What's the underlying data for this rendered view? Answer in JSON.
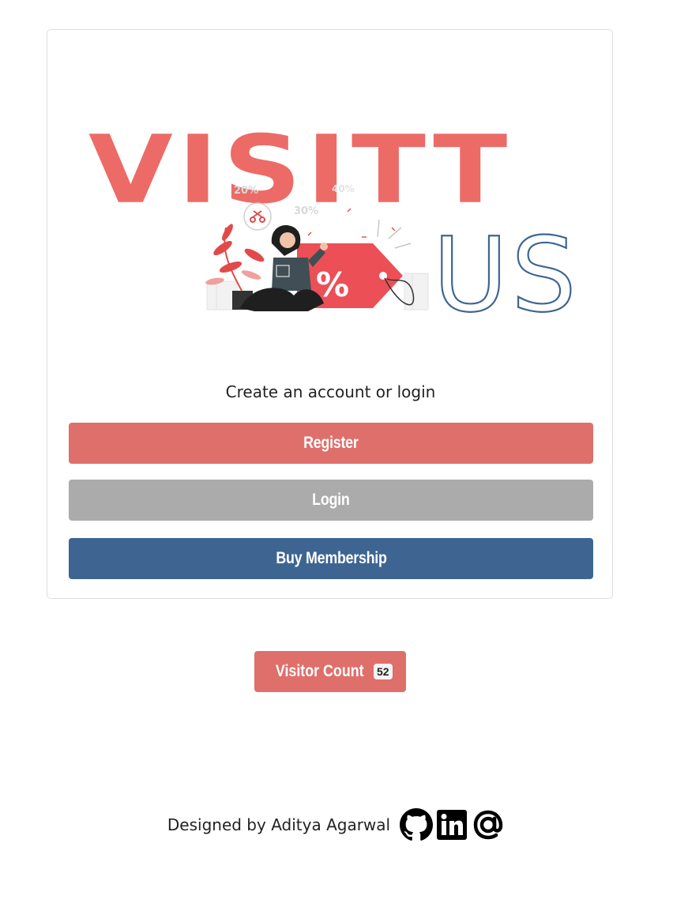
{
  "logo": {
    "wordmark_top": "VISITT",
    "wordmark_bottom": "US",
    "tag_text": "%",
    "percent_labels": [
      "20%",
      "30%",
      "40%"
    ],
    "wordmark_color": "#ec6b67",
    "us_color": "#3e6592"
  },
  "card": {
    "tagline": "Create an account or login",
    "register_label": "Register",
    "login_label": "Login",
    "membership_label": "Buy Membership"
  },
  "visitor": {
    "label": "Visitor Count",
    "count": "52"
  },
  "footer": {
    "credit": "Designed by Aditya Agarwal",
    "icons": [
      "github-icon",
      "linkedin-icon",
      "email-at-icon"
    ]
  },
  "colors": {
    "register": "#df6f6a",
    "login": "#ababab",
    "membership": "#3e6592"
  }
}
